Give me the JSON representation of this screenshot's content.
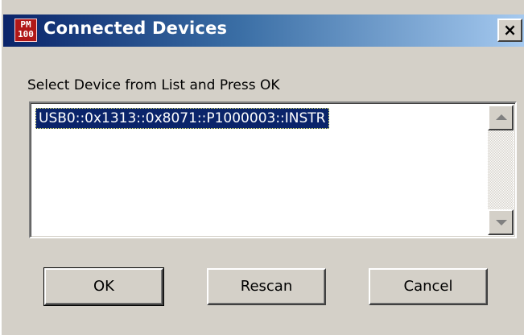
{
  "window": {
    "title": "Connected Devices",
    "close_label": "×"
  },
  "app_icon": {
    "line1": "PM",
    "line2": "100",
    "icon_name": "pm100-app-icon",
    "color": "#b01818"
  },
  "prompt": "Select Device from List and Press OK",
  "devices": {
    "items": [
      "USB0::0x1313::0x8071::P1000003::INSTR"
    ],
    "selected_index": 0
  },
  "buttons": {
    "ok": "OK",
    "rescan": "Rescan",
    "cancel": "Cancel"
  },
  "colors": {
    "titlebar_start": "#0a246a",
    "titlebar_end": "#a6caf0",
    "selection": "#0a246a",
    "dialog_bg": "#d4d0c8"
  }
}
